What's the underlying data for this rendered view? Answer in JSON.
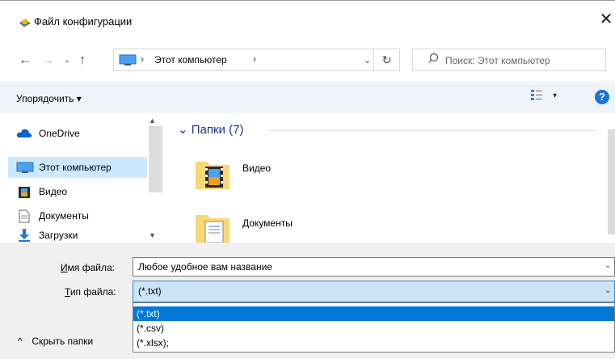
{
  "window": {
    "title": "Файл конфигурации",
    "close_glyph": "✕"
  },
  "nav": {
    "back_glyph": "←",
    "forward_glyph": "→",
    "history_glyph": "⌄",
    "up_glyph": "↑",
    "address": {
      "location": "Этот компьютер",
      "separator": "›",
      "dropdown_glyph": "⌄"
    },
    "refresh_glyph": "↻",
    "search": {
      "placeholder": "Поиск: Этот компьютер"
    }
  },
  "toolbar": {
    "organize_label": "Упорядочить ▾",
    "view_dropdown_glyph": "▾",
    "help_glyph": "?"
  },
  "sidebar": {
    "items": [
      {
        "label": "OneDrive",
        "icon": "cloud-icon"
      },
      {
        "label": "Этот компьютер",
        "icon": "computer-icon",
        "selected": true
      },
      {
        "label": "Видео",
        "icon": "video-icon"
      },
      {
        "label": "Документы",
        "icon": "document-icon"
      },
      {
        "label": "Загрузки",
        "icon": "download-icon"
      }
    ],
    "scroll_up_glyph": "▲",
    "scroll_down_glyph": "▼"
  },
  "content": {
    "group_header": "Папки (7)",
    "group_chevron": "⌄",
    "folders": [
      {
        "label": "Видео",
        "icon": "video-folder-icon"
      },
      {
        "label": "Документы",
        "icon": "documents-folder-icon"
      }
    ]
  },
  "form": {
    "filename_label_prefix": "",
    "filename_label_u": "И",
    "filename_label_rest": "мя файла:",
    "filename_value": "Любое удобное вам название",
    "filetype_label_u": "Т",
    "filetype_label_rest": "ип файла:",
    "filetype_value": "(*.txt)",
    "dropdown_glyph": "⌄",
    "filetype_options": [
      "(*.txt)",
      "(*.csv)",
      "(*.xlsx);"
    ],
    "selected_option_index": 0,
    "hide_folders_label": "Скрыть папки",
    "hide_folders_glyph": "^"
  },
  "colors": {
    "accent": "#0078d7",
    "selection_bg": "#cce8ff",
    "select_bg": "#cce4f7",
    "header_text": "#1e3287",
    "help_icon": "#1a73d9"
  }
}
